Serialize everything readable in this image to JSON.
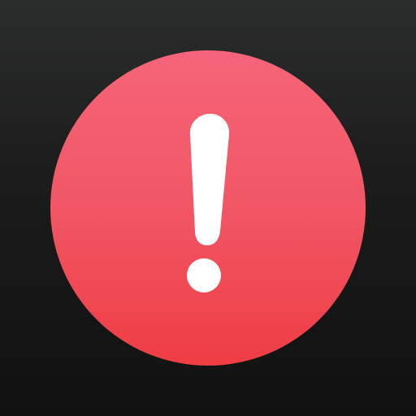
{
  "icon": {
    "name": "exclamation-icon",
    "background_top_color": "#2b2c2c",
    "background_bottom_color": "#111111",
    "circle_top_color": "#f56579",
    "circle_bottom_color": "#ee3d43",
    "glyph_color": "#ffffff"
  }
}
